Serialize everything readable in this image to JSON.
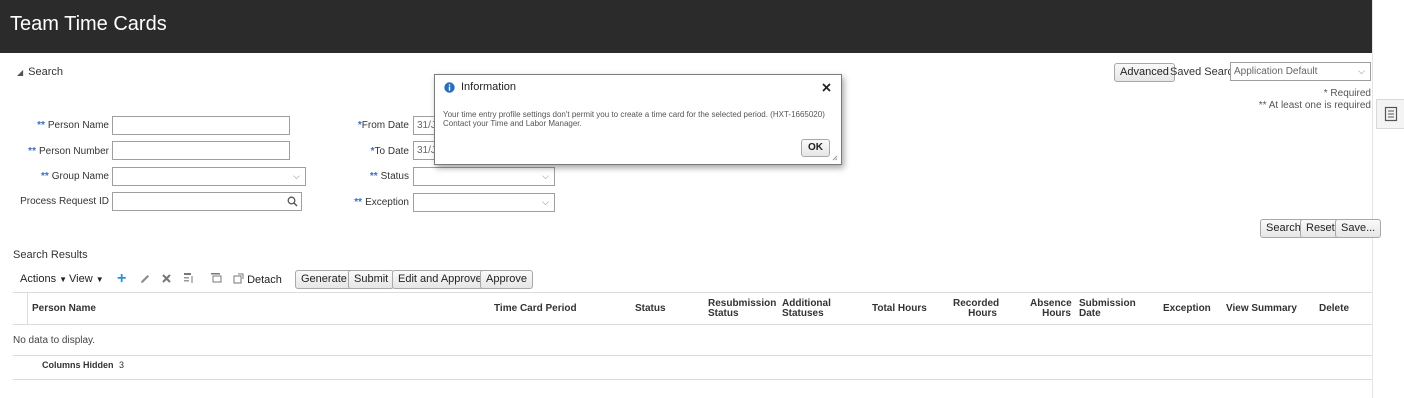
{
  "header": {
    "title": "Team Time Cards"
  },
  "search": {
    "toggle_label": "Search",
    "advanced_label": "Advanced",
    "saved_search_label": "Saved Search",
    "saved_search_value": "Application Default",
    "required_note": "* Required",
    "at_least_one_note": "** At least one is required",
    "fields": {
      "person_name": {
        "label": "Person Name",
        "marker": "**",
        "value": ""
      },
      "person_number": {
        "label": "Person Number",
        "marker": "**",
        "value": ""
      },
      "group_name": {
        "label": "Group Name",
        "marker": "**",
        "value": ""
      },
      "process_request_id": {
        "label": "Process Request ID",
        "value": ""
      },
      "from_date": {
        "label": "From Date",
        "marker": "*",
        "value": "31/J"
      },
      "to_date": {
        "label": "To Date",
        "marker": "*",
        "value": "31/J"
      },
      "status": {
        "label": "Status",
        "marker": "**",
        "value": ""
      },
      "exception": {
        "label": "Exception",
        "marker": "**",
        "value": ""
      }
    },
    "buttons": {
      "search": "Search",
      "reset": "Reset",
      "save": "Save..."
    }
  },
  "results": {
    "title": "Search Results",
    "toolbar": {
      "actions": "Actions",
      "view": "View",
      "detach": "Detach",
      "generate": "Generate",
      "submit": "Submit",
      "edit_and_approve": "Edit and Approve",
      "approve": "Approve"
    },
    "columns": {
      "person_name": "Person Name",
      "time_card_period": "Time Card Period",
      "status": "Status",
      "resubmission_status_1": "Resubmission",
      "resubmission_status_2": "Status",
      "additional_statuses_1": "Additional",
      "additional_statuses_2": "Statuses",
      "total_hours": "Total Hours",
      "recorded_hours_1": "Recorded",
      "recorded_hours_2": "Hours",
      "absence_hours_1": "Absence",
      "absence_hours_2": "Hours",
      "submission_date_1": "Submission",
      "submission_date_2": "Date",
      "exception": "Exception",
      "view_summary": "View Summary",
      "delete": "Delete"
    },
    "empty_message": "No data to display.",
    "columns_hidden_label": "Columns Hidden",
    "columns_hidden_count": "3"
  },
  "dialog": {
    "title": "Information",
    "message": "Your time entry profile settings don't permit you to create a time card for the selected period. (HXT-1665020) Contact your Time and Labor Manager.",
    "ok_label": "OK"
  },
  "colors": {
    "header_bg": "#2b2b2b",
    "required_marker": "#3b6fb6",
    "info_icon": "#2a6ebb",
    "add_icon": "#2a8fd6"
  }
}
